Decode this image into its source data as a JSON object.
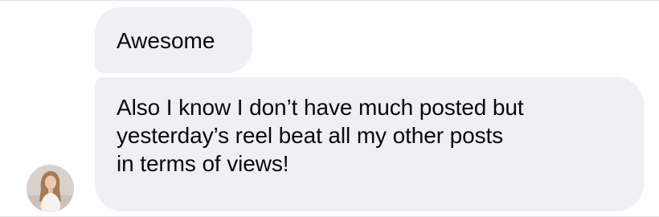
{
  "conversation": {
    "messages": [
      {
        "text": "Awesome"
      },
      {
        "lines": [
          "Also I know I don’t have much posted but",
          "yesterday’s reel beat all my other posts",
          "in terms of views!"
        ]
      }
    ],
    "avatar_icon": "sender-avatar-photo",
    "bubble_color": "#efeff4"
  }
}
